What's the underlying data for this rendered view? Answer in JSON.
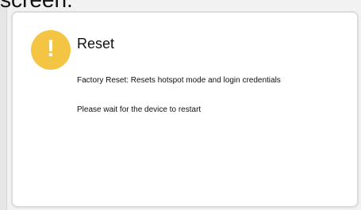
{
  "background": {
    "cut_text": "screen."
  },
  "dialog": {
    "icon": "warning-icon",
    "icon_symbol": "!",
    "icon_color": "#f4c542",
    "title": "Reset",
    "description": "Factory Reset: Resets hotspot mode and login credentials",
    "status": "Please wait for the device to restart"
  }
}
